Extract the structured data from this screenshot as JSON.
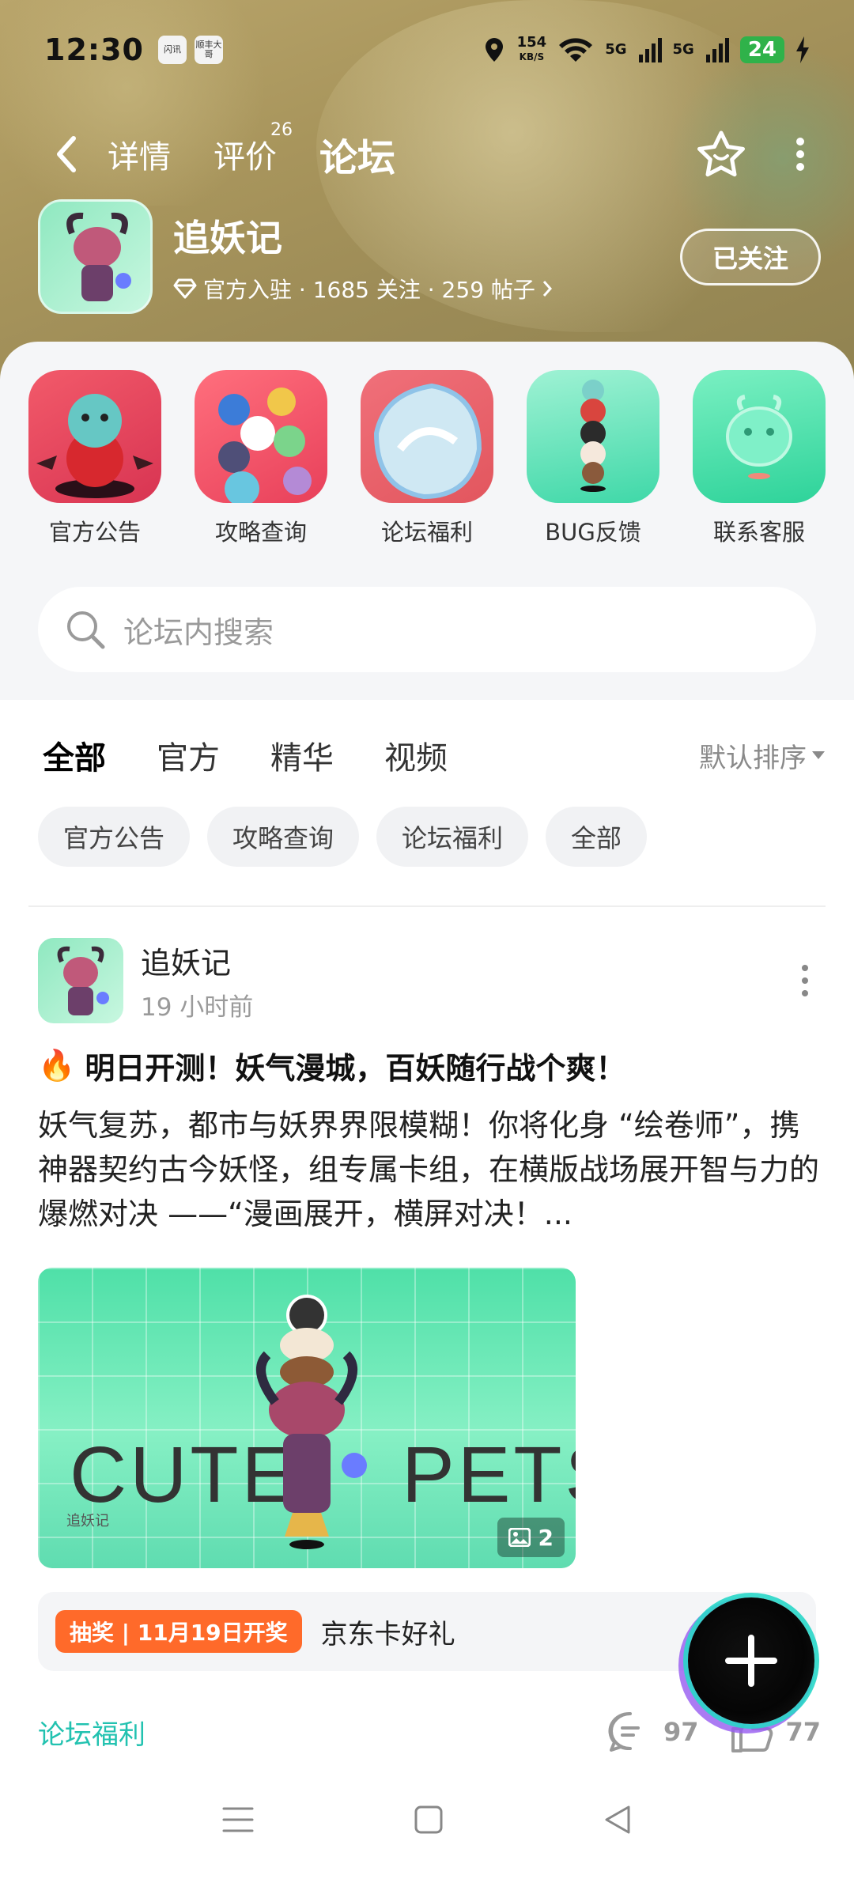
{
  "status_bar": {
    "time": "12:30",
    "app_icon_1": "闪讯",
    "app_icon_2": "顺丰大哥",
    "speed_value": "154",
    "speed_unit": "KB/S",
    "network_1": "5G",
    "network_2": "5G",
    "battery": "24"
  },
  "nav": {
    "tabs": [
      {
        "label": "详情"
      },
      {
        "label": "评价",
        "badge": "26"
      },
      {
        "label": "论坛"
      }
    ],
    "active_tab": "论坛"
  },
  "app": {
    "name": "追妖记",
    "meta": "官方入驻 · 1685 关注 · 259 帖子",
    "follow_label": "已关注"
  },
  "shortcuts": [
    {
      "label": "官方公告"
    },
    {
      "label": "攻略查询"
    },
    {
      "label": "论坛福利"
    },
    {
      "label": "BUG反馈"
    },
    {
      "label": "联系客服"
    }
  ],
  "search": {
    "placeholder": "论坛内搜索"
  },
  "filters": {
    "tabs": [
      "全部",
      "官方",
      "精华",
      "视频"
    ],
    "active": "全部",
    "sort_label": "默认排序"
  },
  "chips": [
    "官方公告",
    "攻略查询",
    "论坛福利",
    "全部"
  ],
  "post": {
    "author": "追妖记",
    "time": "19 小时前",
    "title_emoji": "🔥",
    "title": "明日开测！妖气漫城，百妖随行战个爽！",
    "body": "妖气复苏，都市与妖界界限模糊！你将化身 “绘卷师”，携神器契约古今妖怪，组专属卡组，在横版战场展开智与力的爆燃对决 ——“漫画展开，横屏对决！...",
    "image_text_left": "CUTE",
    "image_text_right": "PETS",
    "image_caption": "追妖记",
    "image_count": "2",
    "lottery_badge": "抽奖 | 11月19日开奖",
    "lottery_text": "京东卡好礼",
    "category": "论坛福利",
    "comments": "97",
    "likes": "77"
  },
  "colors": {
    "accent": "#2fd4c0",
    "category_text": "#22c2b0",
    "lottery_badge": "#ff6a2a"
  }
}
